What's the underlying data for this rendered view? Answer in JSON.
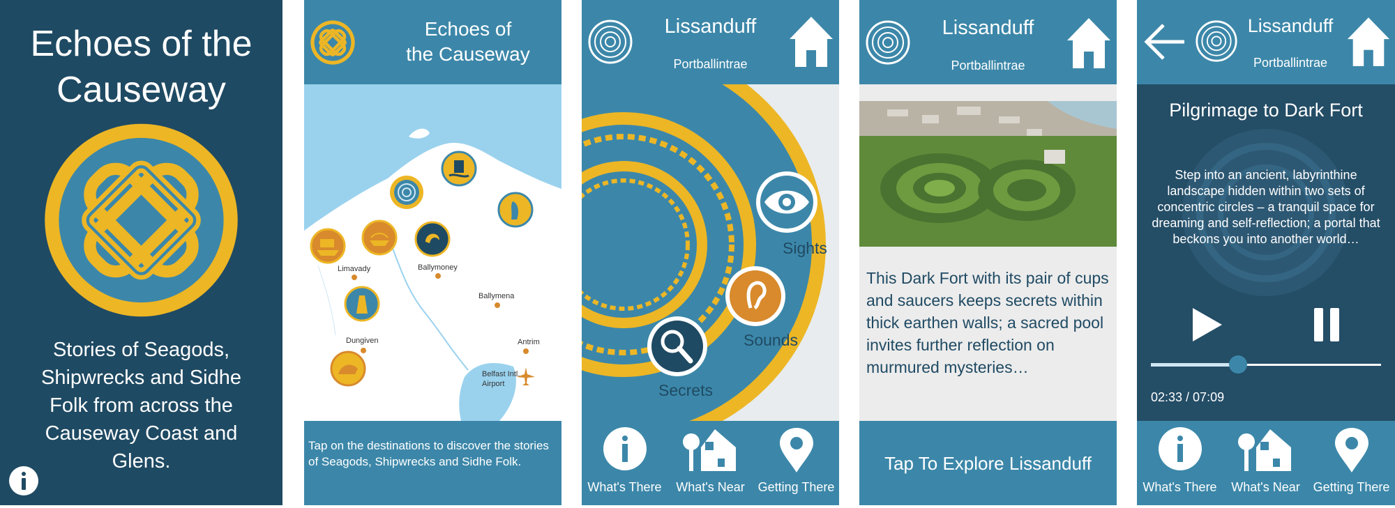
{
  "splash": {
    "title": "Echoes of the Causeway",
    "tagline": "Stories of Seagods, Shipwrecks and Sidhe Folk from across the Causeway Coast and Glens.",
    "info_icon": "info-icon"
  },
  "map_screen": {
    "header_title_line1": "Echoes of",
    "header_title_line2": "the Causeway",
    "towns": [
      "Limavady",
      "Ballymoney",
      "Ballymena",
      "Antrim",
      "Dungiven",
      "Belfast Intl.",
      "Airport"
    ],
    "footer_text": "Tap on the destinations to discover the stories of Seagods, Shipwrecks and Sidhe Folk."
  },
  "site_menu": {
    "header_title": "Lissanduff",
    "header_subtitle": "Portballintrae",
    "options": [
      "Sights",
      "Sounds",
      "Secrets"
    ]
  },
  "site_detail": {
    "header_title": "Lissanduff",
    "header_subtitle": "Portballintrae",
    "description": "This Dark Fort with its pair of cups and saucers keeps secrets within thick earthen walls; a sacred pool invites further reflection on murmured mysteries…",
    "cta": "Tap To Explore Lissanduff"
  },
  "audio_player": {
    "header_title": "Lissanduff",
    "header_subtitle": "Portballintrae",
    "track_title": "Pilgrimage to Dark Fort",
    "track_description": "Step into an ancient, labyrinthine landscape hidden within two sets of concentric circles – a tranquil space for dreaming and self-reflection; a portal that beckons you into another world…",
    "time": "02:33 / 07:09",
    "progress": 0.38
  },
  "bottom_nav": {
    "whats_there": "What's There",
    "whats_near": "What's Near",
    "getting_there": "Getting There"
  },
  "colors": {
    "navy": "#1f4a63",
    "teal": "#3c87a9",
    "gold": "#edb625",
    "orange": "#d88a2c",
    "sea": "#9ad2ee"
  }
}
